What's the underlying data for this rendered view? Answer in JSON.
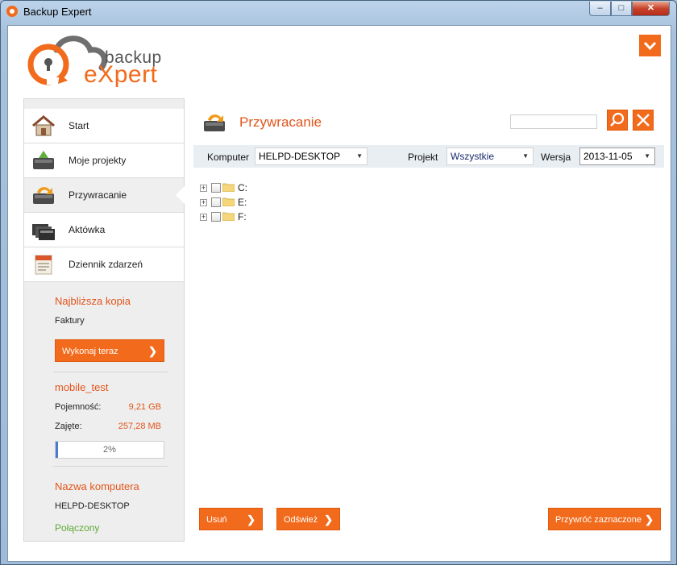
{
  "window": {
    "title": "Backup Expert",
    "controls": {
      "minimize": "–",
      "maximize": "□",
      "close": "✕"
    }
  },
  "brand": {
    "line1": "backup",
    "line2": "eXpert",
    "accent": "#f26a1b"
  },
  "sidebar": {
    "items": [
      {
        "label": "Start",
        "icon": "home-icon"
      },
      {
        "label": "Moje projekty",
        "icon": "projects-icon"
      },
      {
        "label": "Przywracanie",
        "icon": "restore-icon",
        "active": true
      },
      {
        "label": "Aktówka",
        "icon": "briefcase-icon"
      },
      {
        "label": "Dziennik zdarzeń",
        "icon": "calendar-log-icon"
      }
    ],
    "next_backup": {
      "title": "Najbliższa kopia",
      "name": "Faktury",
      "button": "Wykonaj teraz"
    },
    "storage": {
      "title": "mobile_test",
      "capacity_label": "Pojemność:",
      "capacity_value": "9,21 GB",
      "used_label": "Zajęte:",
      "used_value": "257,28 MB",
      "progress_percent": 2,
      "progress_text": "2%"
    },
    "computer": {
      "title": "Nazwa komputera",
      "name": "HELPD-DESKTOP",
      "status": "Połączony"
    }
  },
  "main": {
    "title": "Przywracanie",
    "search": {
      "placeholder": ""
    },
    "filters": {
      "computer_label": "Komputer",
      "computer_value": "HELPD-DESKTOP",
      "project_label": "Projekt",
      "project_value": "Wszystkie",
      "version_label": "Wersja",
      "version_value": "2013-11-05"
    },
    "tree": [
      {
        "label": "C:"
      },
      {
        "label": "E:"
      },
      {
        "label": "F:"
      }
    ],
    "buttons": {
      "delete": "Usuń",
      "refresh": "Odśwież",
      "restore": "Przywróć zaznaczone"
    }
  }
}
